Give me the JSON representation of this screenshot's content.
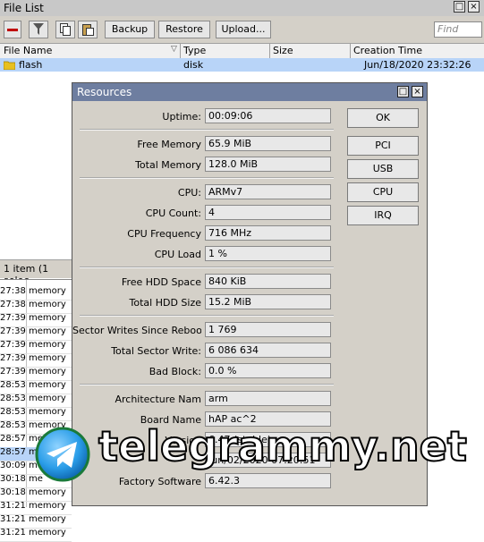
{
  "file_list": {
    "title": "File List",
    "toolbar": {
      "backup": "Backup",
      "restore": "Restore",
      "upload": "Upload..."
    },
    "find_placeholder": "Find",
    "columns": [
      "File Name",
      "Type",
      "Size",
      "Creation Time"
    ],
    "rows": [
      {
        "name": "flash",
        "type": "disk",
        "size": "",
        "created": "Jun/18/2020 23:32:26"
      }
    ],
    "status": "1 item (1 selec"
  },
  "log": {
    "rows": [
      {
        "time": "27:38",
        "topic": "memory"
      },
      {
        "time": "27:38",
        "topic": "memory"
      },
      {
        "time": "27:39",
        "topic": "memory"
      },
      {
        "time": "27:39",
        "topic": "memory"
      },
      {
        "time": "27:39",
        "topic": "memory"
      },
      {
        "time": "27:39",
        "topic": "memory"
      },
      {
        "time": "27:39",
        "topic": "memory"
      },
      {
        "time": "28:53",
        "topic": "memory"
      },
      {
        "time": "28:53",
        "topic": "memory"
      },
      {
        "time": "28:53",
        "topic": "memory"
      },
      {
        "time": "28:53",
        "topic": "memory"
      },
      {
        "time": "28:57",
        "topic": "memory"
      },
      {
        "time": "28:57",
        "topic": "me"
      },
      {
        "time": "30:09",
        "topic": "me"
      },
      {
        "time": "30:18",
        "topic": "me"
      },
      {
        "time": "30:18",
        "topic": "memory"
      },
      {
        "time": "31:21",
        "topic": "memory"
      },
      {
        "time": "31:21",
        "topic": "memory"
      },
      {
        "time": "31:21",
        "topic": "memory"
      }
    ]
  },
  "resources": {
    "title": "Resources",
    "fields": {
      "uptime": {
        "label": "Uptime:",
        "value": "00:09:06"
      },
      "free_memory": {
        "label": "Free Memory",
        "value": "65.9 MiB"
      },
      "total_memory": {
        "label": "Total Memory",
        "value": "128.0 MiB"
      },
      "cpu": {
        "label": "CPU:",
        "value": "ARMv7"
      },
      "cpu_count": {
        "label": "CPU Count:",
        "value": "4"
      },
      "cpu_frequency": {
        "label": "CPU Frequency",
        "value": "716 MHz"
      },
      "cpu_load": {
        "label": "CPU Load",
        "value": "1 %"
      },
      "free_hdd": {
        "label": "Free HDD Space",
        "value": "840 KiB"
      },
      "total_hdd": {
        "label": "Total HDD Size",
        "value": "15.2 MiB"
      },
      "sector_writes_reboot": {
        "label": "Sector Writes Since Reboo",
        "value": "1 769"
      },
      "total_sector_writes": {
        "label": "Total Sector Write:",
        "value": "6 086 634"
      },
      "bad_blocks": {
        "label": "Bad Block:",
        "value": "0.0 %"
      },
      "architecture": {
        "label": "Architecture Nam",
        "value": "arm"
      },
      "board_name": {
        "label": "Board Name",
        "value": "hAP ac^2"
      },
      "version": {
        "label": "Version",
        "value": "6.47 (stable)"
      },
      "build_time": {
        "label": "",
        "value": "Jun/02/2020 07:20:51"
      },
      "factory_software": {
        "label": "Factory Software",
        "value": "6.42.3"
      }
    },
    "buttons": {
      "ok": "OK",
      "pci": "PCI",
      "usb": "USB",
      "cpu": "CPU",
      "irq": "IRQ"
    }
  },
  "watermark": {
    "text": "telegrammy.net"
  },
  "colors": {
    "title_bar": "#6e7ea0",
    "selection": "#b8d4f8",
    "dialog_bg": "#d4d0c8"
  }
}
